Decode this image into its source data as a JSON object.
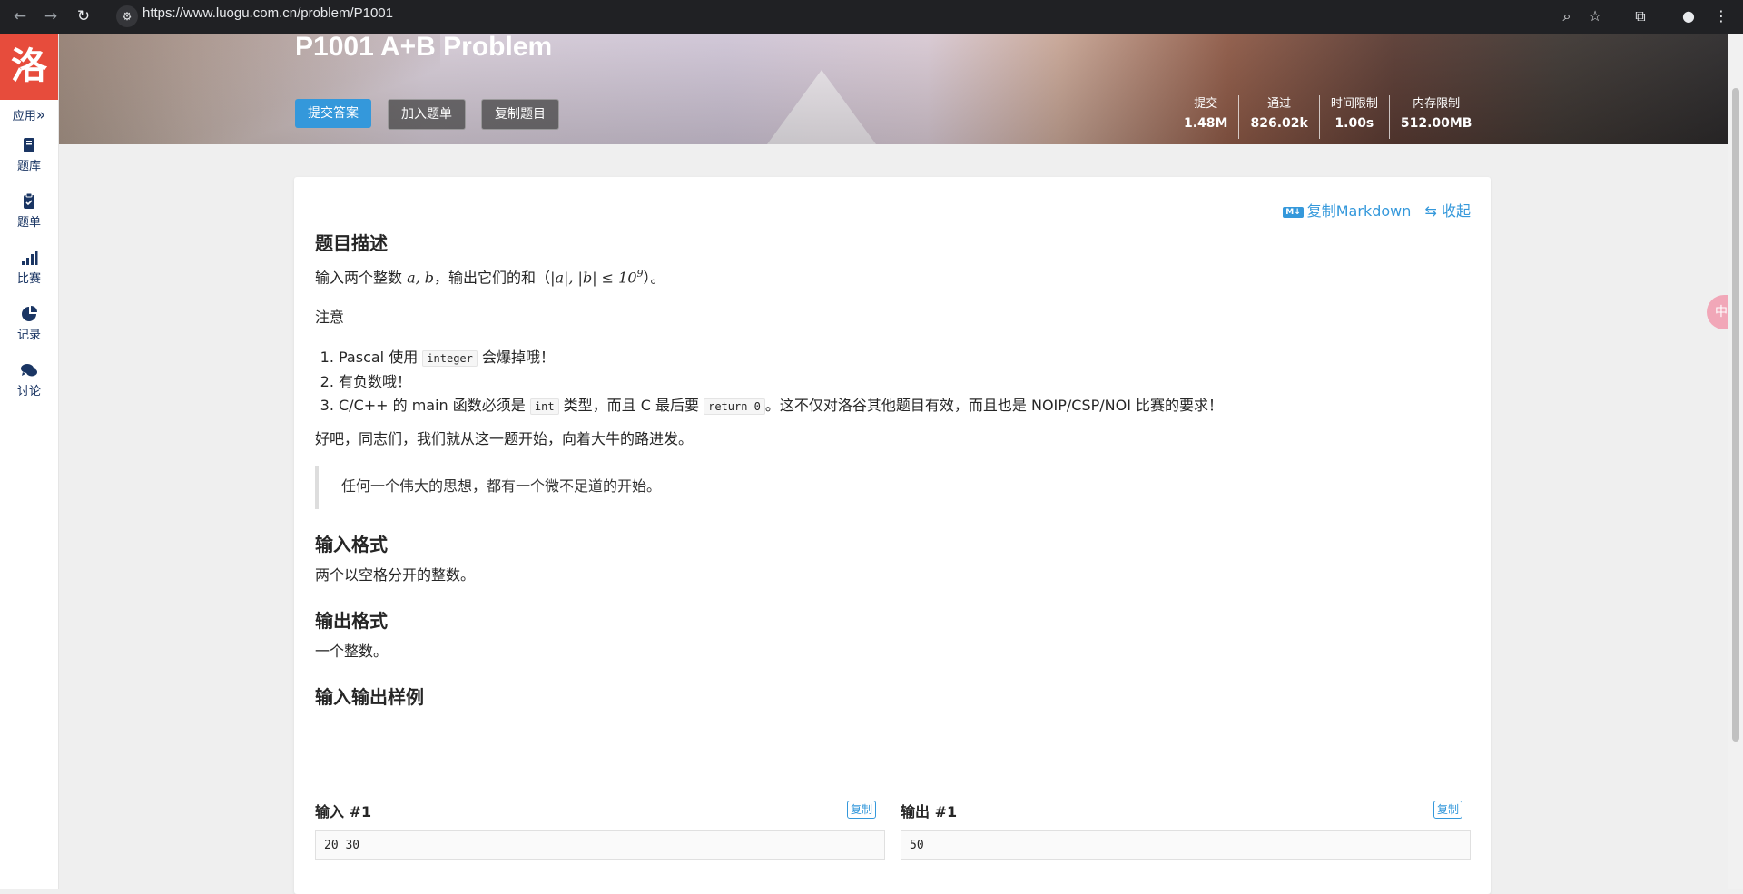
{
  "browser": {
    "url": "https://www.luogu.com.cn/problem/P1001"
  },
  "sidebar": {
    "logo": "洛",
    "apps_label": "应用",
    "apps_arrow": "»",
    "items": [
      {
        "label": "题库",
        "icon": "book-icon"
      },
      {
        "label": "题单",
        "icon": "clipboard-icon"
      },
      {
        "label": "比赛",
        "icon": "signal-bars-icon"
      },
      {
        "label": "记录",
        "icon": "pie-chart-icon"
      },
      {
        "label": "讨论",
        "icon": "comments-icon"
      }
    ]
  },
  "banner": {
    "title": "P1001 A+B Problem",
    "buttons": {
      "submit": "提交答案",
      "add_to_list": "加入题单",
      "copy_problem": "复制题目"
    },
    "stats": [
      {
        "label": "提交",
        "value": "1.48M"
      },
      {
        "label": "通过",
        "value": "826.02k"
      },
      {
        "label": "时间限制",
        "value": "1.00s"
      },
      {
        "label": "内存限制",
        "value": "512.00MB"
      }
    ]
  },
  "card": {
    "tools": {
      "md_badge": "M↓",
      "copy_markdown": "复制Markdown",
      "collapse": "收起"
    },
    "description": {
      "heading": "题目描述",
      "intro_prefix": "输入两个整数 ",
      "intro_vars": "a, b",
      "intro_mid": "，输出它们的和（",
      "intro_math": "|a|, |b| ≤ 10",
      "intro_exp": "9",
      "intro_suffix": "）。",
      "note_label": "注意",
      "list": [
        {
          "pre": "Pascal 使用 ",
          "code": "integer",
          "post": " 会爆掉哦！"
        },
        {
          "pre": "有负数哦！",
          "code": "",
          "post": ""
        },
        {
          "pre": "C/C++ 的 main 函数必须是 ",
          "code": "int",
          "mid": " 类型，而且 C 最后要 ",
          "code2": "return 0",
          "post": "。这不仅对洛谷其他题目有效，而且也是 NOIP/CSP/NOI 比赛的要求！"
        }
      ],
      "closing": "好吧，同志们，我们就从这一题开始，向着大牛的路进发。",
      "quote": "任何一个伟大的思想，都有一个微不足道的开始。"
    },
    "input_format": {
      "heading": "输入格式",
      "text": "两个以空格分开的整数。"
    },
    "output_format": {
      "heading": "输出格式",
      "text": "一个整数。"
    },
    "samples": {
      "heading": "输入输出样例",
      "input_label": "输入 #1",
      "output_label": "输出 #1",
      "copy_label": "复制",
      "input_value": "20 30",
      "output_value": "50"
    }
  },
  "ime": "中",
  "colors": {
    "accent": "#3498db",
    "logo": "#e74c3c",
    "sidebar_text": "#1a3563"
  }
}
